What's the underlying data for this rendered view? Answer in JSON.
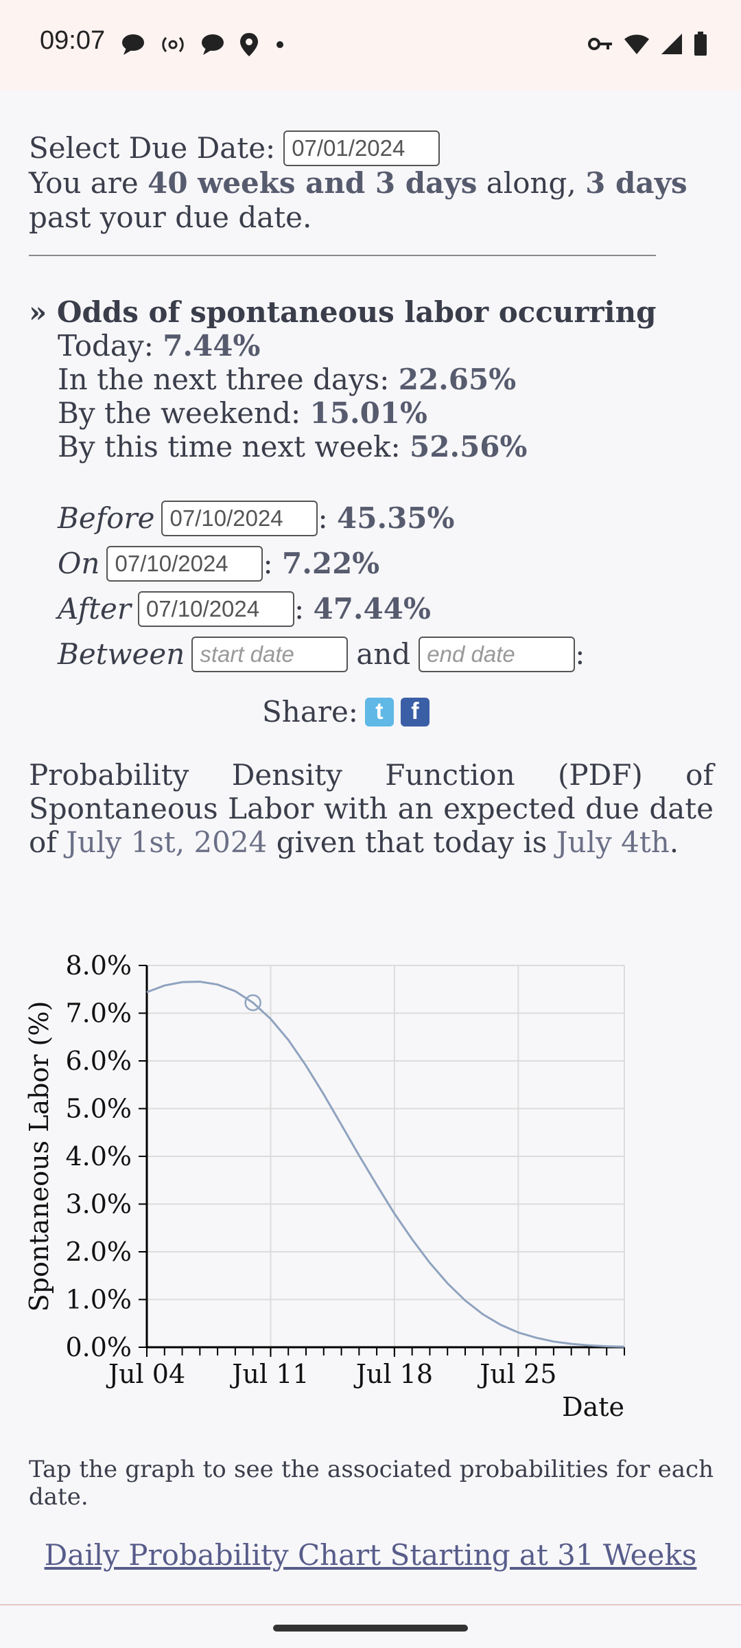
{
  "status_bar": {
    "time": "09:07",
    "left_icons": [
      "chat-bubble-icon",
      "radio-icon",
      "chat-bubble-icon",
      "location-icon",
      "dot-icon"
    ],
    "right_icons": [
      "key-icon",
      "wifi-icon",
      "signal-icon",
      "battery-icon"
    ]
  },
  "due": {
    "label": "Select Due Date:",
    "value": "07/01/2024",
    "sentence_prefix": "You are",
    "weeks": "40 weeks and 3 days",
    "sentence_mid": "along,",
    "days_past": "3 days",
    "sentence_suffix": "past your due date."
  },
  "odds": {
    "title": "» Odds of spontaneous labor occurring",
    "today_label": "Today:",
    "today": "7.44%",
    "three_days_label": "In the next three days:",
    "three_days": "22.65%",
    "weekend_label": "By the weekend:",
    "weekend": "15.01%",
    "next_week_label": "By this time next week:",
    "next_week": "52.56%"
  },
  "specific": {
    "before_label": "Before",
    "before_date": "07/10/2024",
    "before_value": "45.35%",
    "on_label": "On",
    "on_date": "07/10/2024",
    "on_value": "7.22%",
    "after_label": "After",
    "after_date": "07/10/2024",
    "after_value": "47.44%",
    "between_label": "Between",
    "start_placeholder": "start date",
    "and_label": "and",
    "end_placeholder": "end date",
    "colon": ":",
    "sep": ":"
  },
  "share": {
    "label": "Share:"
  },
  "pdf": {
    "text1": "Probability Density Function (PDF) of Spontaneous Labor with an expected due date of",
    "due_date": "July 1st, 2024",
    "text2": "given that today is",
    "today_date": "July 4th",
    "period": "."
  },
  "chart_data": {
    "type": "line",
    "ylabel": "Spontaneous Labor (%)",
    "xlabel": "Date",
    "y_ticks": [
      "0.0%",
      "1.0%",
      "2.0%",
      "3.0%",
      "4.0%",
      "5.0%",
      "6.0%",
      "7.0%",
      "8.0%"
    ],
    "x_ticks": [
      "Jul 04",
      "Jul 11",
      "Jul 18",
      "Jul 25"
    ],
    "ylim": [
      0,
      8
    ],
    "xlim": [
      "2024-07-04",
      "2024-07-31"
    ],
    "grid": true,
    "highlight": {
      "x": "2024-07-10",
      "y": 7.22
    },
    "series": [
      {
        "x": [
          "2024-07-04",
          "2024-07-05",
          "2024-07-06",
          "2024-07-07",
          "2024-07-08",
          "2024-07-09",
          "2024-07-10",
          "2024-07-11",
          "2024-07-12",
          "2024-07-13",
          "2024-07-14",
          "2024-07-15",
          "2024-07-16",
          "2024-07-17",
          "2024-07-18",
          "2024-07-19",
          "2024-07-20",
          "2024-07-21",
          "2024-07-22",
          "2024-07-23",
          "2024-07-24",
          "2024-07-25",
          "2024-07-26",
          "2024-07-27",
          "2024-07-28",
          "2024-07-29",
          "2024-07-30",
          "2024-07-31"
        ],
        "y": [
          7.44,
          7.58,
          7.65,
          7.66,
          7.6,
          7.46,
          7.22,
          6.88,
          6.44,
          5.9,
          5.3,
          4.66,
          4.02,
          3.4,
          2.8,
          2.26,
          1.77,
          1.34,
          0.98,
          0.69,
          0.47,
          0.31,
          0.2,
          0.12,
          0.07,
          0.04,
          0.02,
          0.01
        ]
      }
    ],
    "color": "#8fa3bf"
  },
  "note": "Tap the graph to see the associated probabilities for each date.",
  "link": "Daily Probability Chart Starting at 31 Weeks"
}
